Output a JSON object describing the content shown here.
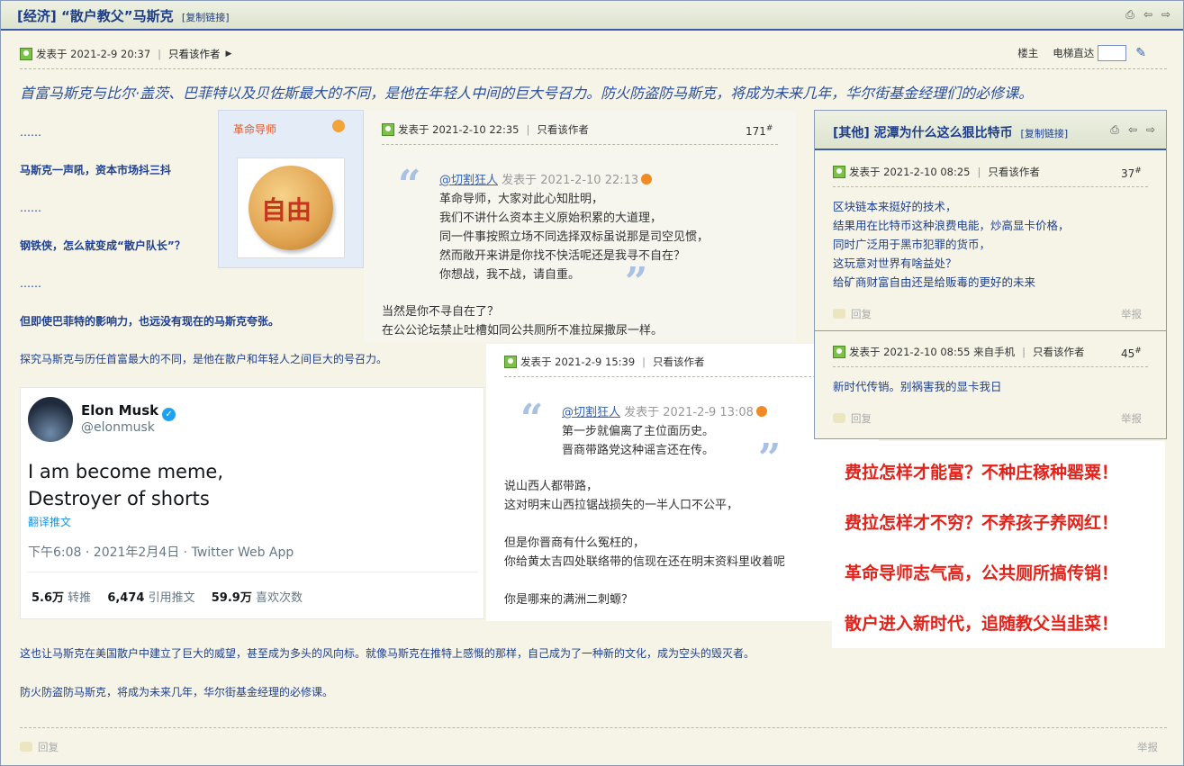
{
  "thread": {
    "category": "[经济]",
    "title": "“散户教父”马斯克",
    "copy_link": "[复制链接]"
  },
  "post_meta": {
    "posted": "发表于 2021-2-9 20:37",
    "author_only": "只看该作者",
    "floor_label": "楼主",
    "elevator": "电梯直达"
  },
  "lead": "首富马斯克与比尔·盖茨、巴菲特以及贝佐斯最大的不同，是他在年轻人中间的巨大号召力。防火防盗防马斯克，将成为未来几年，华尔街基金经理们的必修课。",
  "body": {
    "dots1": "……",
    "line1": "马斯克一声吼，资本市场抖三抖",
    "dots2": "……",
    "line2": "钢铁侠，怎么就变成“散户队长”？",
    "dots3": "……",
    "line3": "但即使巴菲特的影响力，也远没有现在的马斯克夸张。",
    "line4": "探究马斯克与历任首富最大的不同，是他在散户和年轻人之间巨大的号召力。",
    "line5": "这也让马斯克在美国散户中建立了巨大的威望，甚至成为多头的风向标。就像马斯克在推特上感慨的那样，自己成为了一种新的文化，成为空头的毁灭者。",
    "line6": "防火防盗防马斯克，将成为未来几年，华尔街基金经理的必修课。"
  },
  "footer": {
    "reply": "回复",
    "report": "举报"
  },
  "mentor": {
    "name": "革命导师",
    "avatar_text": "自由"
  },
  "reply1": {
    "posted": "发表于 2021-2-10 22:35",
    "author_only": "只看该作者",
    "floor": "171",
    "quote_user": "@切割狂人",
    "quote_time": "发表于 2021-2-10 22:13",
    "quote_lines": [
      "革命导师，大家对此心知肚明，",
      "我们不讲什么资本主义原始积累的大道理，",
      "同一件事按照立场不同选择双标虽说那是司空见惯，",
      "然而敞开来讲是你找不快活呢还是我寻不自在？",
      "你想战，我不战，请自重。"
    ],
    "lines": [
      "当然是你不寻自在了？",
      "在公公论坛禁止吐槽如同公共厕所不准拉屎撒尿一样。"
    ]
  },
  "tweet": {
    "name": "Elon Musk",
    "handle": "@elonmusk",
    "text1": "I am become meme,",
    "text2": "Destroyer of shorts",
    "translate": "翻译推文",
    "time": "下午6:08 · 2021年2月4日 · Twitter Web App",
    "retweets_num": "5.6万",
    "retweets_label": "转推",
    "quotes_num": "6,474",
    "quotes_label": "引用推文",
    "likes_num": "59.9万",
    "likes_label": "喜欢次数"
  },
  "reply2": {
    "posted": "发表于 2021-2-9 15:39",
    "author_only": "只看该作者",
    "quote_user": "@切割狂人",
    "quote_time": "发表于 2021-2-9 13:08",
    "quote_lines": [
      "第一步就偏离了主位面历史。",
      "晋商带路党这种谣言还在传。"
    ],
    "lines": [
      "说山西人都带路，",
      "这对明末山西拉锯战损失的一半人口不公平，",
      "",
      "但是你晋商有什么冤枉的，",
      "你给黄太吉四处联络带的信现在还在明末资料里收着呢",
      "",
      "你是哪来的满洲二刺螈？"
    ]
  },
  "rpanel": {
    "category": "[其他]",
    "title": "泥潭为什么这么狠比特币",
    "copy_link": "[复制链接]",
    "post1": {
      "posted": "发表于 2021-2-10 08:25",
      "author_only": "只看该作者",
      "floor": "37",
      "lines": [
        "区块链本来挺好的技术，",
        "结果用在比特币这种浪费电能，炒高显卡价格，",
        "同时广泛用于黑市犯罪的货币，",
        "这玩意对世界有啥益处？",
        "给矿商财富自由还是给贩毒的更好的未来"
      ]
    },
    "post2": {
      "posted": "发表于 2021-2-10 08:55 来自手机",
      "author_only": "只看该作者",
      "floor": "45",
      "line": "新时代传销。别祸害我的显卡我日"
    }
  },
  "slogans": [
    "费拉怎样才能富？不种庄稼种罂粟！",
    "费拉怎样才不穷？不养孩子养网红！",
    "革命导师志气高，公共厕所搞传销！",
    "散户进入新时代，追随教父当韭菜！"
  ]
}
